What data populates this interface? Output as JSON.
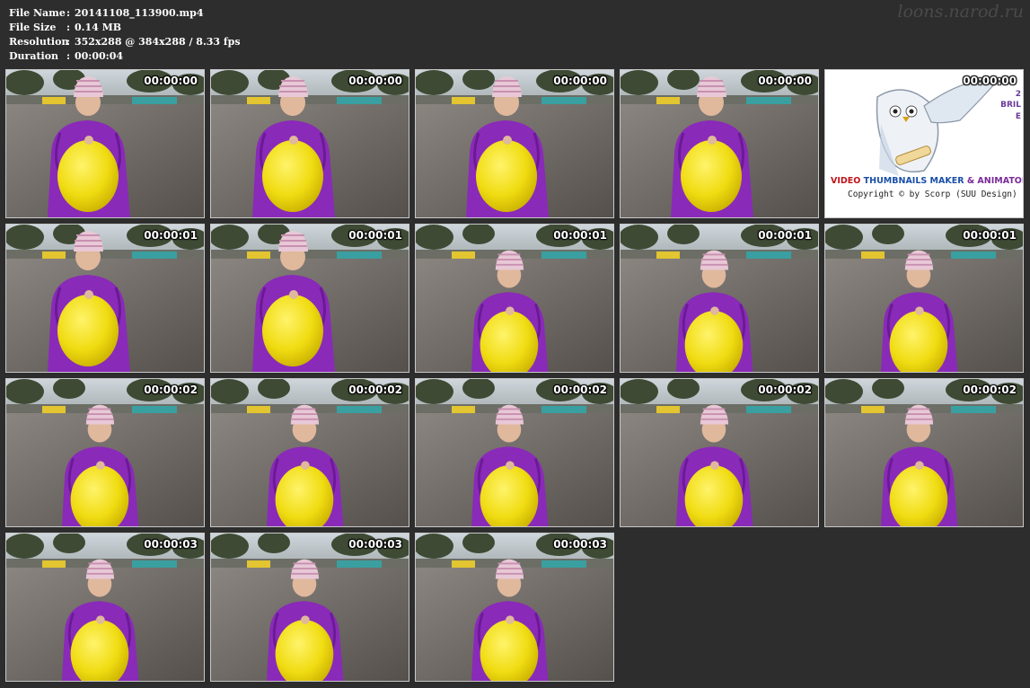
{
  "info": {
    "rows": [
      {
        "key": "File Name",
        "sep": ":",
        "value": "20141108_113900.mp4"
      },
      {
        "key": "File Size",
        "sep": ":",
        "value": "0.14 MB"
      },
      {
        "key": "Resolution",
        "sep": ":",
        "value": "352x288 @ 384x288 / 8.33 fps"
      },
      {
        "key": "Duration",
        "sep": ":",
        "value": "00:00:04"
      }
    ]
  },
  "watermark": "loons.narod.ru",
  "logo": {
    "timestamp": "00:00:00",
    "line1_a": "VIDEO",
    "line1_b": "THUMBNAILS MAKER",
    "line1_c": "& ANIMATOR",
    "line2": "Copyright © by Scorp (SUU Design)",
    "side_1": "2",
    "side_2": "BRIL",
    "side_3": "E"
  },
  "thumbnails": [
    {
      "timestamp": "00:00:00",
      "variant": "a"
    },
    {
      "timestamp": "00:00:00",
      "variant": "a"
    },
    {
      "timestamp": "00:00:00",
      "variant": "b"
    },
    {
      "timestamp": "00:00:00",
      "variant": "b"
    },
    {
      "timestamp": "00:00:01",
      "variant": "a"
    },
    {
      "timestamp": "00:00:01",
      "variant": "a"
    },
    {
      "timestamp": "00:00:01",
      "variant": "c"
    },
    {
      "timestamp": "00:00:01",
      "variant": "c"
    },
    {
      "timestamp": "00:00:01",
      "variant": "c"
    },
    {
      "timestamp": "00:00:02",
      "variant": "c"
    },
    {
      "timestamp": "00:00:02",
      "variant": "c"
    },
    {
      "timestamp": "00:00:02",
      "variant": "c"
    },
    {
      "timestamp": "00:00:02",
      "variant": "c"
    },
    {
      "timestamp": "00:00:02",
      "variant": "c"
    },
    {
      "timestamp": "00:00:03",
      "variant": "c"
    },
    {
      "timestamp": "00:00:03",
      "variant": "c"
    },
    {
      "timestamp": "00:00:03",
      "variant": "c"
    }
  ]
}
